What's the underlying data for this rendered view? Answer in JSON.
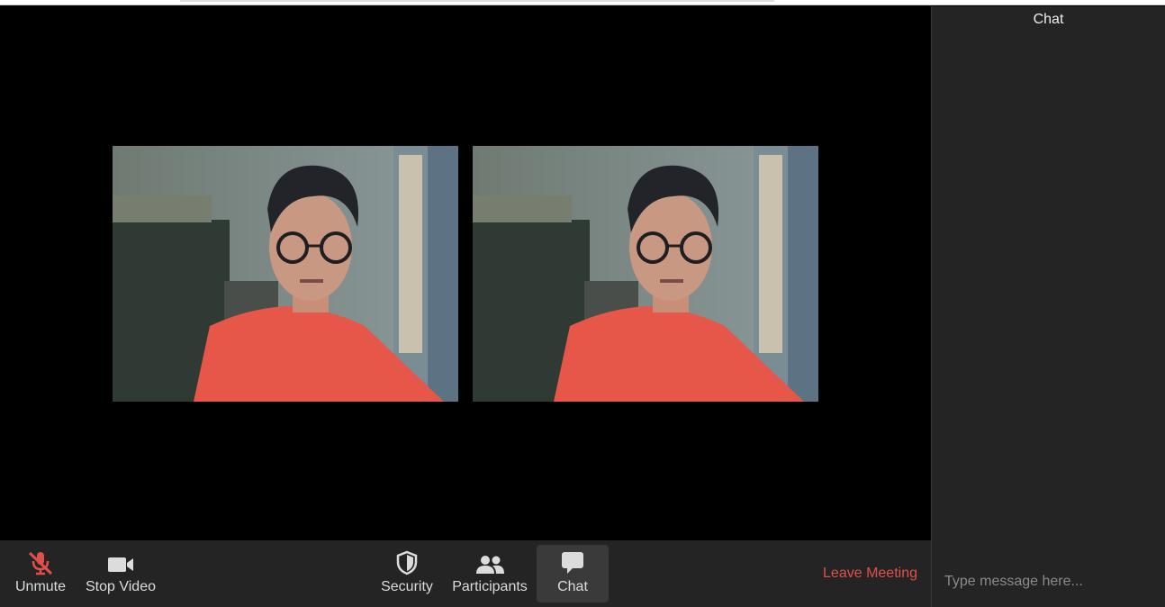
{
  "toolbar": {
    "unmute_label": "Unmute",
    "stop_video_label": "Stop Video",
    "security_label": "Security",
    "participants_label": "Participants",
    "chat_label": "Chat",
    "leave_label": "Leave Meeting"
  },
  "icons": {
    "unmute": "mic-muted-icon",
    "stop_video": "video-camera-icon",
    "security": "shield-icon",
    "participants": "people-icon",
    "chat": "chat-bubble-icon"
  },
  "colors": {
    "toolbar_bg": "#242424",
    "leave": "#e0504a",
    "muted_mic": "#e0504a",
    "active_button_bg": "#3a3a3a"
  },
  "chat_panel": {
    "title": "Chat",
    "input_placeholder": "Type message here..."
  }
}
